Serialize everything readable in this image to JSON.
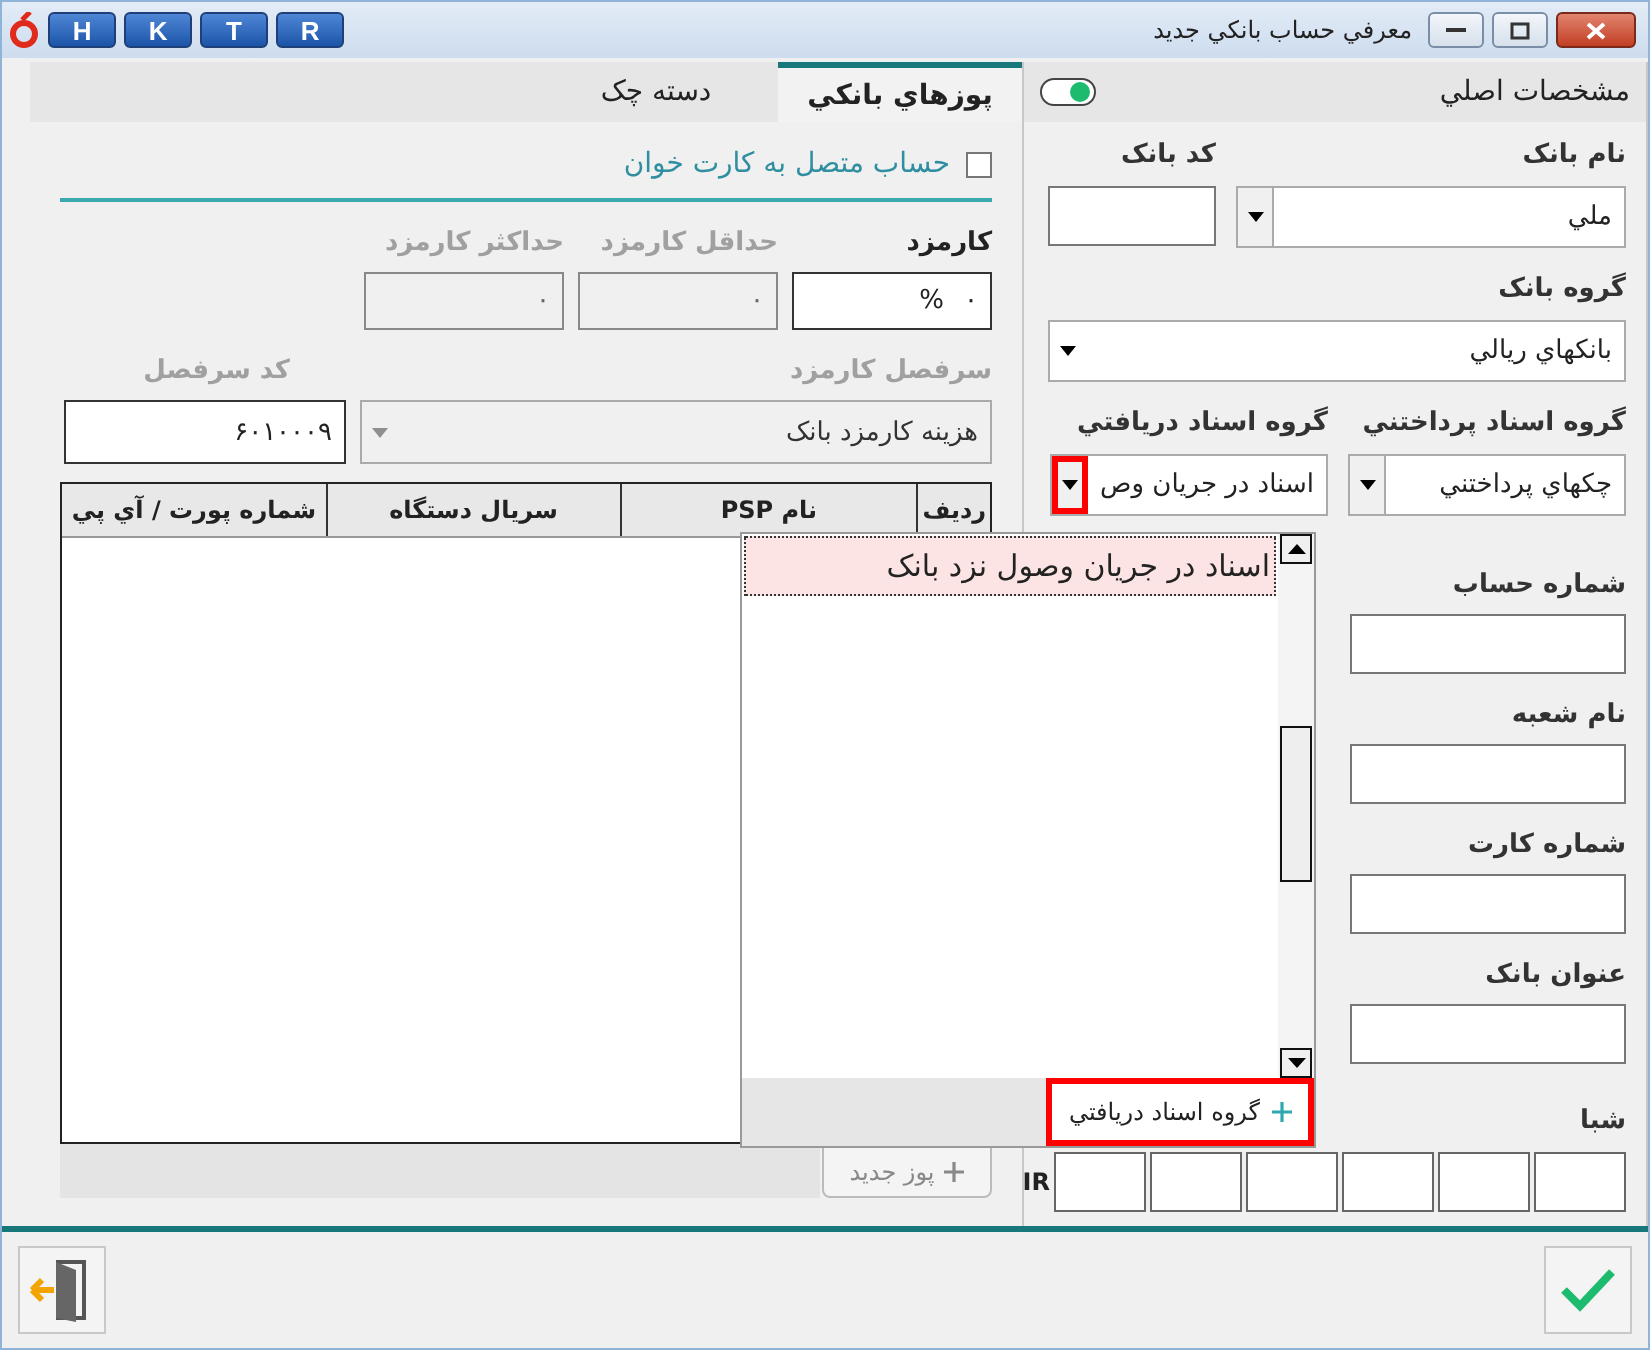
{
  "window": {
    "title": "معرفي حساب بانکي جديد",
    "quick_buttons": [
      "R",
      "T",
      "K",
      "H"
    ]
  },
  "tabs": [
    {
      "label": "پوزهاي بانکي",
      "selected": true
    },
    {
      "label": "دسته چک",
      "selected": false
    }
  ],
  "card_reader": {
    "label": "حساب متصل به کارت خوان",
    "checked": false
  },
  "fee_fields": [
    {
      "label": "کارمزد",
      "value": "۰",
      "suffix": "%",
      "disabled": false
    },
    {
      "label": "حداقل کارمزد",
      "value": "۰",
      "disabled": true
    },
    {
      "label": "حداکثر کارمزد",
      "value": "۰",
      "disabled": true
    }
  ],
  "fee_account": {
    "label": "سرفصل کارمزد",
    "value": "هزينه کارمزد بانک",
    "disabled": true
  },
  "account_code": {
    "label": "کد سرفصل",
    "value": "۶۰۱۰۰۰۹",
    "disabled": false
  },
  "pos_table": {
    "columns": [
      "رديف",
      "نام PSP",
      "سريال دستگاه",
      "شماره پورت / آي پي"
    ]
  },
  "new_pos_button": {
    "label": "پوز جديد",
    "disabled": true
  },
  "main_panel": {
    "title": "مشخصات اصلي",
    "toggle_on": true
  },
  "bank_name": {
    "label": "نام بانک",
    "value": "ملي"
  },
  "bank_code": {
    "label": "کد بانک"
  },
  "bank_group": {
    "label": "گروه بانک",
    "value": "بانکهاي ريالي"
  },
  "payable_group": {
    "label": "گروه اسناد پرداختني",
    "value": "چکهاي پرداختني",
    "highlighted": false
  },
  "receivable_group": {
    "label": "گروه اسناد دريافتي",
    "value": "اسناد در جريان وص",
    "highlighted": true,
    "expanded": true
  },
  "text_fields": [
    {
      "label": "شماره حساب"
    },
    {
      "label": "نام شعبه"
    },
    {
      "label": "شماره کارت"
    },
    {
      "label": "عنوان بانک"
    }
  ],
  "iban": {
    "label": "شبا",
    "prefix": "IR"
  },
  "dropdown_list": {
    "items": [
      {
        "label": "اسناد در جريان وصول نزد بانک",
        "selected": true
      }
    ],
    "add_button": {
      "label": "گروه اسناد دريافتي",
      "highlighted": true
    }
  }
}
